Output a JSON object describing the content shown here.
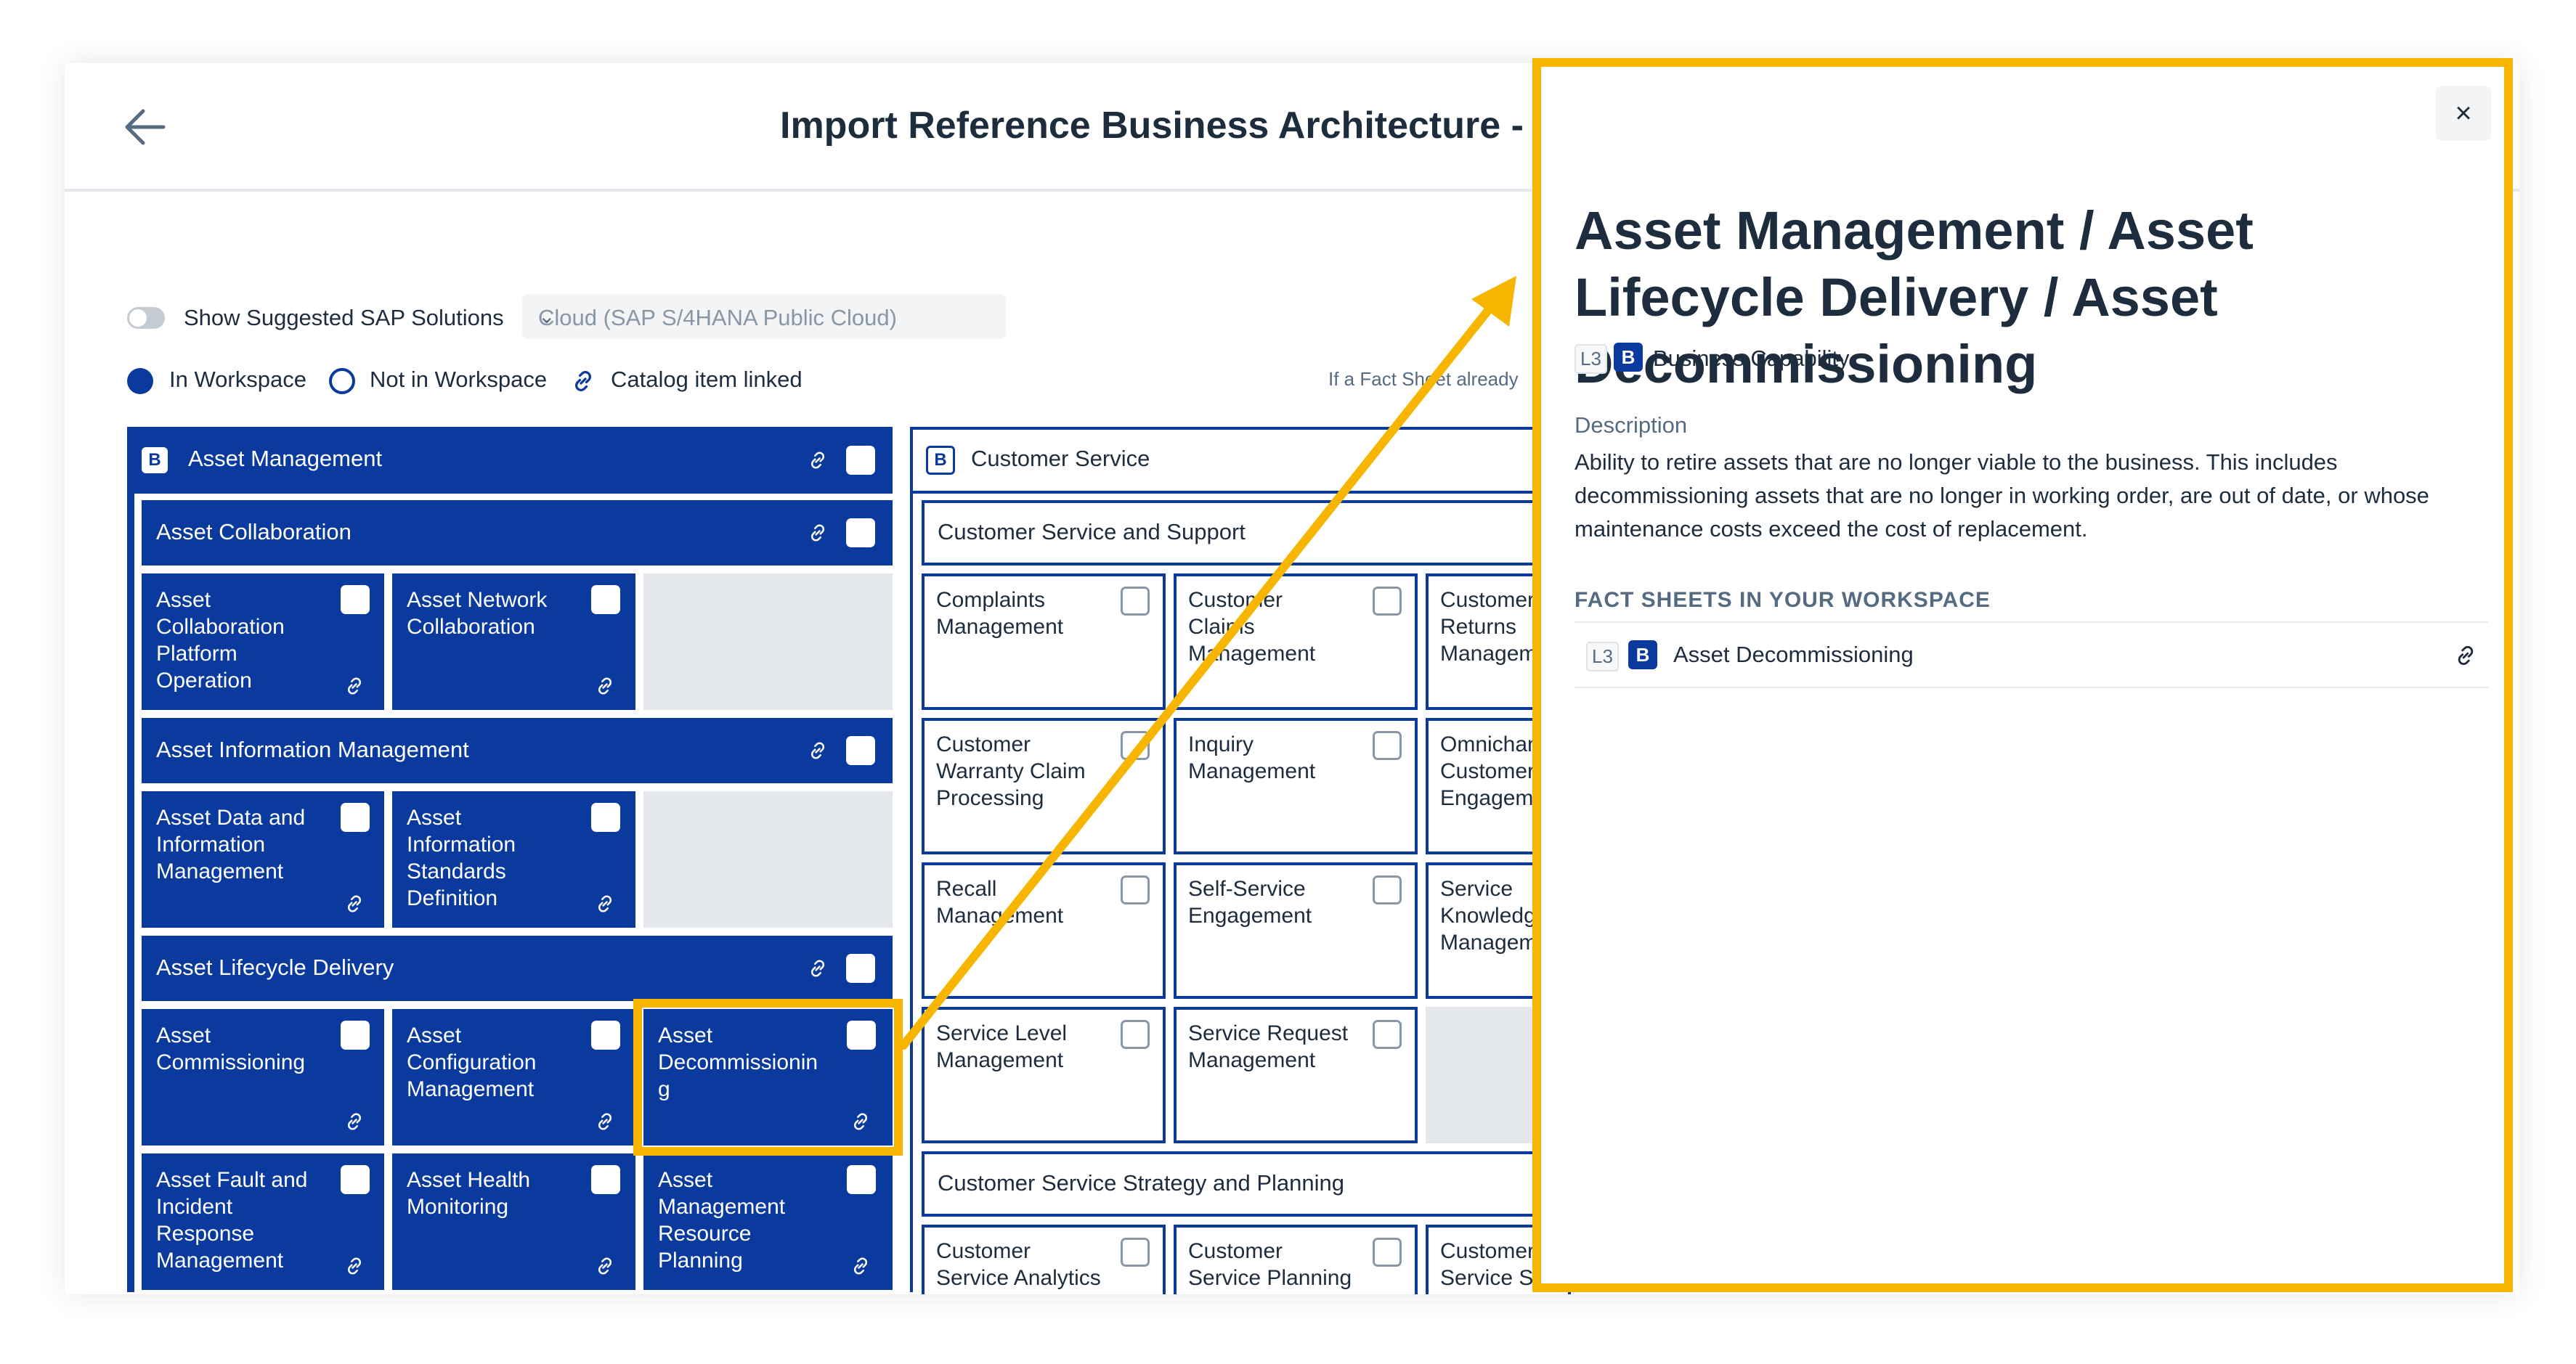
{
  "header": {
    "title": "Import Reference Business Architecture -"
  },
  "filters": {
    "show_suggested_label": "Show Suggested SAP Solutions",
    "cloud_select_value": "Cloud (SAP S/4HANA Public Cloud)"
  },
  "legend": {
    "in_workspace": "In Workspace",
    "not_in_workspace": "Not in Workspace",
    "catalog_linked": "Catalog item linked",
    "hint": "If a Fact Sheet already"
  },
  "badge_b": "B",
  "left_domain": {
    "label": "Asset Management",
    "groups": [
      {
        "label": "Asset Collaboration",
        "tiles": [
          "Asset Collaboration Platform Operation",
          "Asset Network Collaboration"
        ]
      },
      {
        "label": "Asset Information Management",
        "tiles": [
          "Asset Data and Information Management",
          "Asset Information Standards Definition"
        ]
      },
      {
        "label": "Asset Lifecycle Delivery",
        "tiles": [
          "Asset Commissioning",
          "Asset Configuration Management",
          "Asset Decommissionin g",
          "Asset Fault and Incident Response Management",
          "Asset Health Monitoring",
          "Asset Management Resource Planning"
        ]
      }
    ]
  },
  "right_domain": {
    "label": "Customer Service",
    "groups": [
      {
        "label": "Customer Service and Support",
        "tiles": [
          "Complaints Management",
          "Customer Claims Management",
          "Customer Returns Managem",
          "Customer Warranty Claim Processing",
          "Inquiry Management",
          "Omnichan Customer Engagem",
          "Recall Management",
          "Self-Service Engagement",
          "Service Knowledg Managem",
          "Service Level Management",
          "Service Request Management"
        ]
      },
      {
        "label": "Customer Service Strategy and Planning",
        "tiles": [
          "Customer Service Analytics",
          "Customer Service Planning",
          "Customer Service S"
        ]
      }
    ]
  },
  "panel": {
    "title": "Asset Management / Asset Lifecycle Delivery / Asset Decommissioning",
    "level": "L3",
    "type_label": "Business Capability",
    "description_label": "Description",
    "description": "Ability to retire assets that are no longer viable to the business. This includes decommissioning assets that are no longer in working order, are out of date, or whose maintenance costs exceed the cost of replacement.",
    "fact_sheets_heading": "FACT SHEETS IN YOUR WORKSPACE",
    "fact_sheet": {
      "level": "L3",
      "name": "Asset Decommissioning"
    },
    "close_symbol": "×"
  },
  "colors": {
    "primary": "#0a3a9e",
    "highlight": "#f7b500",
    "empty_tile": "#e4e7eb"
  }
}
